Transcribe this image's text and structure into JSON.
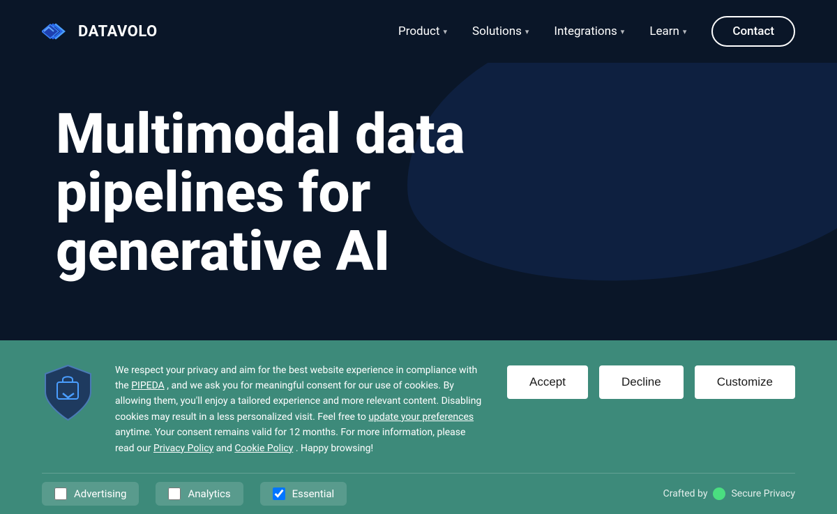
{
  "nav": {
    "logo_text": "DATAVOLO",
    "items": [
      {
        "label": "Product",
        "has_dropdown": true
      },
      {
        "label": "Solutions",
        "has_dropdown": true
      },
      {
        "label": "Integrations",
        "has_dropdown": true
      },
      {
        "label": "Learn",
        "has_dropdown": true
      }
    ],
    "contact_label": "Contact"
  },
  "hero": {
    "title_line1": "Multimodal data",
    "title_line2": "pipelines for",
    "title_line3": "generative AI"
  },
  "cookie": {
    "body_text": "We respect your privacy and aim for the best website experience in compliance with the",
    "pipeda_link": "PIPEDA",
    "body_text2": ", and we ask you for meaningful consent for our use of cookies. By allowing them, you'll enjoy a tailored experience and more relevant content. Disabling cookies may result in a less personalized visit. Feel free to",
    "preferences_link": "update your preferences",
    "body_text3": "anytime. Your consent remains valid for 12 months. For more information, please read our",
    "privacy_link": "Privacy Policy",
    "and_text": "and",
    "cookie_link": "Cookie Policy",
    "happy_text": ". Happy browsing!",
    "accept_label": "Accept",
    "decline_label": "Decline",
    "customize_label": "Customize",
    "categories": [
      {
        "label": "Advertising",
        "checked": false
      },
      {
        "label": "Analytics",
        "checked": false
      },
      {
        "label": "Essential",
        "checked": true
      }
    ],
    "crafted_prefix": "Crafted by",
    "crafted_brand": "Secure Privacy"
  }
}
